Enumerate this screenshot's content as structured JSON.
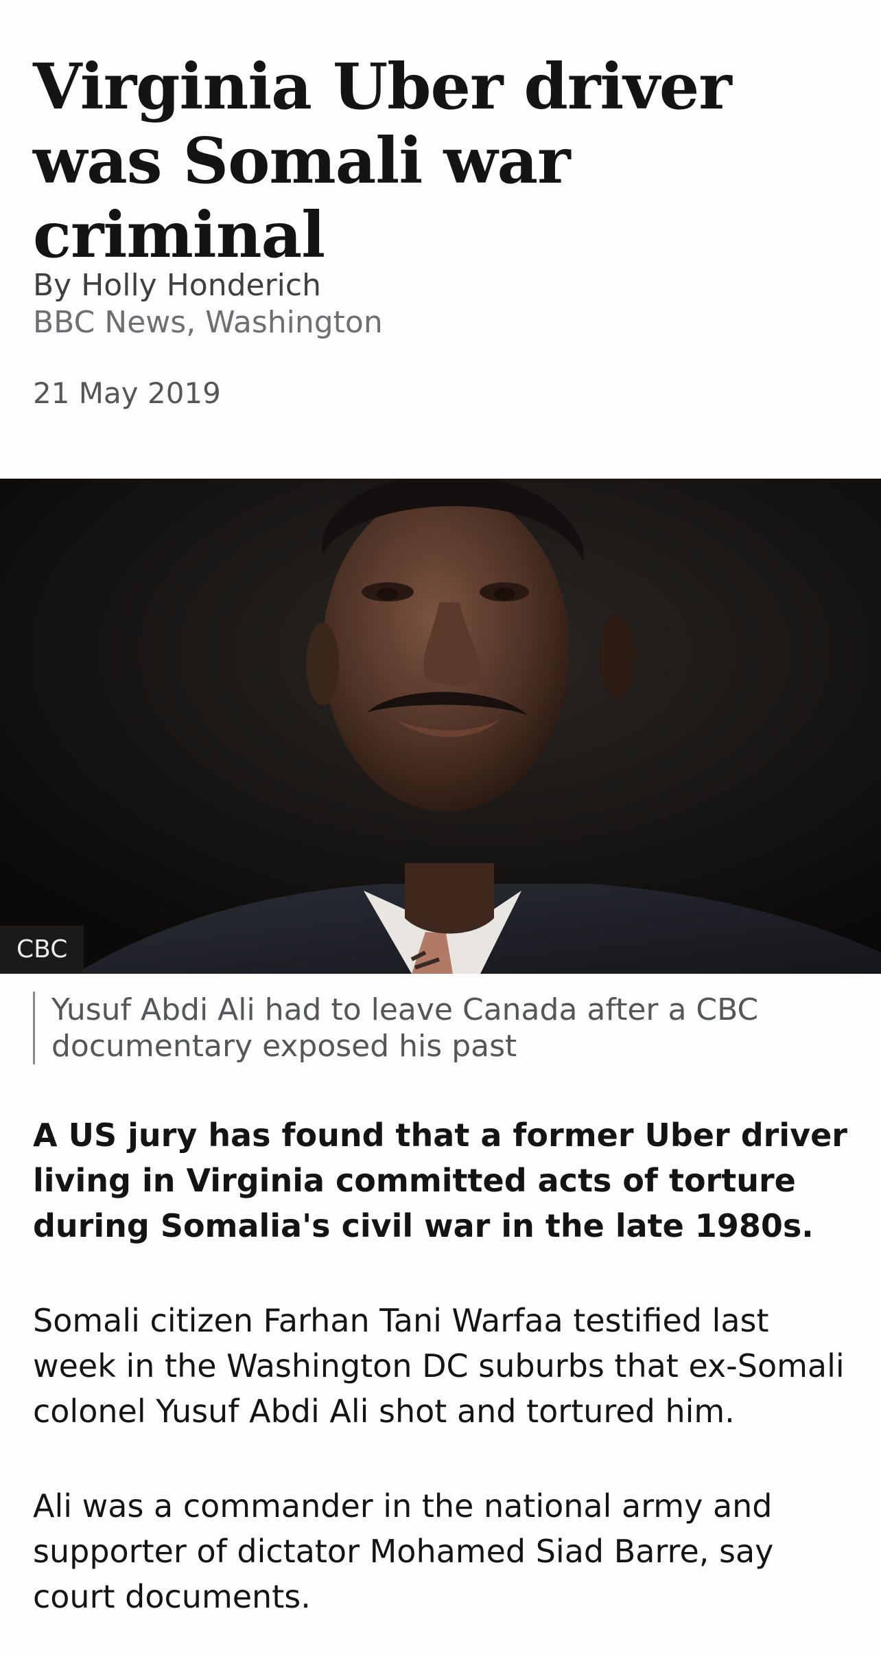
{
  "article": {
    "headline": "Virginia Uber driver was Somali war criminal",
    "byline": {
      "author": "By Holly Honderich",
      "role": "BBC News, Washington"
    },
    "date": "21 May 2019",
    "image": {
      "copyright": "CBC",
      "caption": "Yusuf Abdi Ali had to leave Canada after a CBC documentary exposed his past"
    },
    "lede": "A US jury has found that a former Uber driver living in Virginia committed acts of torture during Somalia's civil war in the late 1980s.",
    "paragraphs": [
      "Somali citizen Farhan Tani Warfaa testified last week in the Washington DC suburbs that ex-Somali colonel Yusuf Abdi Ali shot and tortured him.",
      "Ali was a commander in the national army and supporter of dictator Mohamed Siad Barre, say court documents."
    ]
  },
  "colors": {
    "background": "#fdfdfd",
    "headline": "#141414",
    "secondary_text": "#545658",
    "caption_rule": "#8a8a8a"
  }
}
